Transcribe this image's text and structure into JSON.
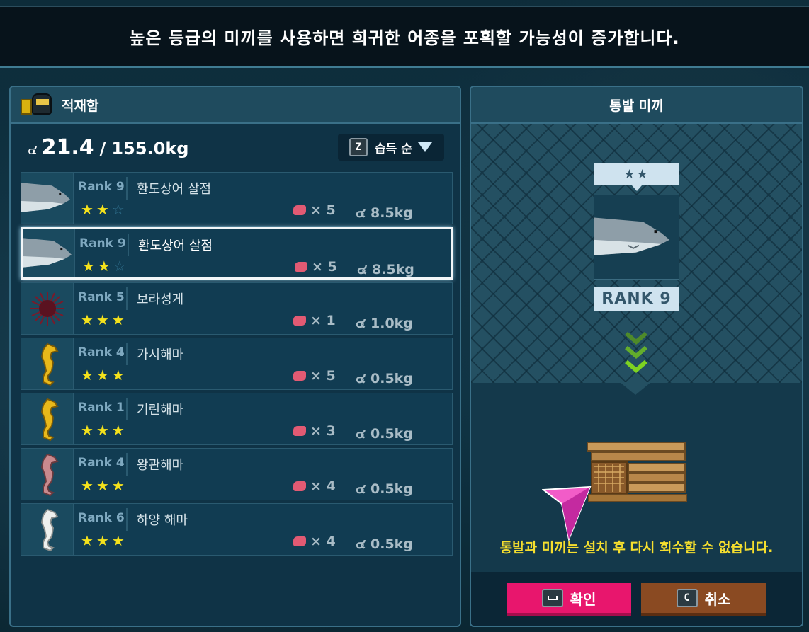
{
  "banner": {
    "text": "높은 등급의 미끼를 사용하면 희귀한 어종을 포획할 가능성이 증가합니다."
  },
  "inventory": {
    "title": "적재함",
    "weight_current": "21.4",
    "weight_separator": "/",
    "weight_max": "155.0kg",
    "sort": {
      "key": "Z",
      "label": "습득 순"
    },
    "items": [
      {
        "rank": "Rank 9",
        "name": "환도상어 살점",
        "stars": 2,
        "max_stars": 3,
        "bait": "× 5",
        "weight": "8.5kg",
        "thumb": "shark",
        "selected": false
      },
      {
        "rank": "Rank 9",
        "name": "환도상어 살점",
        "stars": 2,
        "max_stars": 3,
        "bait": "× 5",
        "weight": "8.5kg",
        "thumb": "shark",
        "selected": true
      },
      {
        "rank": "Rank 5",
        "name": "보라성게",
        "stars": 3,
        "max_stars": 3,
        "bait": "× 1",
        "weight": "1.0kg",
        "thumb": "urchin",
        "selected": false
      },
      {
        "rank": "Rank 4",
        "name": "가시해마",
        "stars": 3,
        "max_stars": 3,
        "bait": "× 5",
        "weight": "0.5kg",
        "thumb": "seahorse-yellow",
        "selected": false
      },
      {
        "rank": "Rank 1",
        "name": "기린해마",
        "stars": 3,
        "max_stars": 3,
        "bait": "× 3",
        "weight": "0.5kg",
        "thumb": "seahorse-yellow",
        "selected": false
      },
      {
        "rank": "Rank 4",
        "name": "왕관해마",
        "stars": 3,
        "max_stars": 3,
        "bait": "× 4",
        "weight": "0.5kg",
        "thumb": "seahorse-pink",
        "selected": false
      },
      {
        "rank": "Rank 6",
        "name": "하양 해마",
        "stars": 3,
        "max_stars": 3,
        "bait": "× 4",
        "weight": "0.5kg",
        "thumb": "seahorse-white",
        "selected": false
      }
    ]
  },
  "trap": {
    "title": "통발 미끼",
    "star_tag": "★★",
    "rank_tag": "RANK 9",
    "warning": "통발과 미끼는 설치 후 다시 회수할 수 없습니다.",
    "confirm_label": "확인",
    "cancel_key": "C",
    "cancel_label": "취소"
  },
  "colors": {
    "accent_confirm": "#e8166d",
    "accent_cancel": "#8a4a22",
    "star": "#f4e21c",
    "warning": "#f6df2e",
    "chevron": "#7ed321"
  }
}
